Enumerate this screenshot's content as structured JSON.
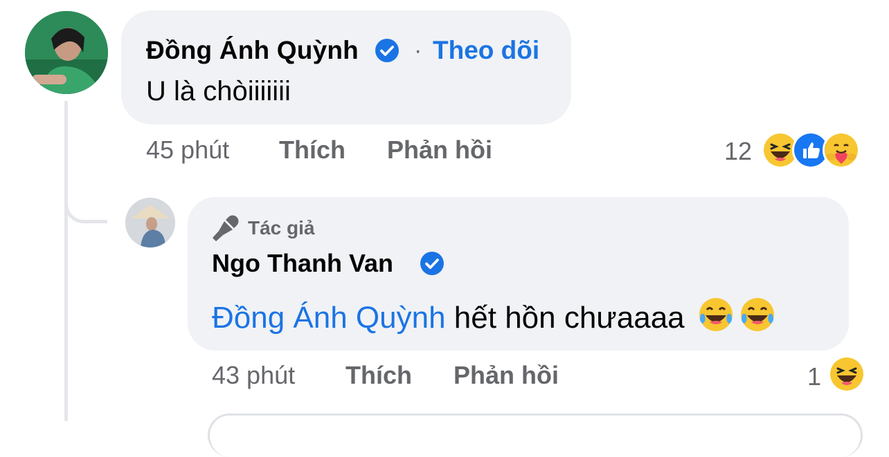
{
  "comment1": {
    "author": "Đồng Ánh Quỳnh",
    "follow_label": "Theo dõi",
    "separator": "·",
    "text": "U là chòiiiiiii",
    "time": "45 phút",
    "like_label": "Thích",
    "reply_label": "Phản hồi",
    "reaction_count": "12",
    "reactions": [
      "haha-icon",
      "like-icon",
      "care-icon"
    ]
  },
  "reply1": {
    "author_badge": "Tác giả",
    "author": "Ngo Thanh Van",
    "mention": "Đồng Ánh Quỳnh",
    "text": "hết hồn chưaaaa",
    "time": "43 phút",
    "like_label": "Thích",
    "reply_label": "Phản hồi",
    "reaction_count": "1",
    "reactions": [
      "haha-icon"
    ]
  },
  "colors": {
    "link": "#1b74e4",
    "bubble": "#f0f2f5",
    "secondary_text": "#65676b"
  }
}
